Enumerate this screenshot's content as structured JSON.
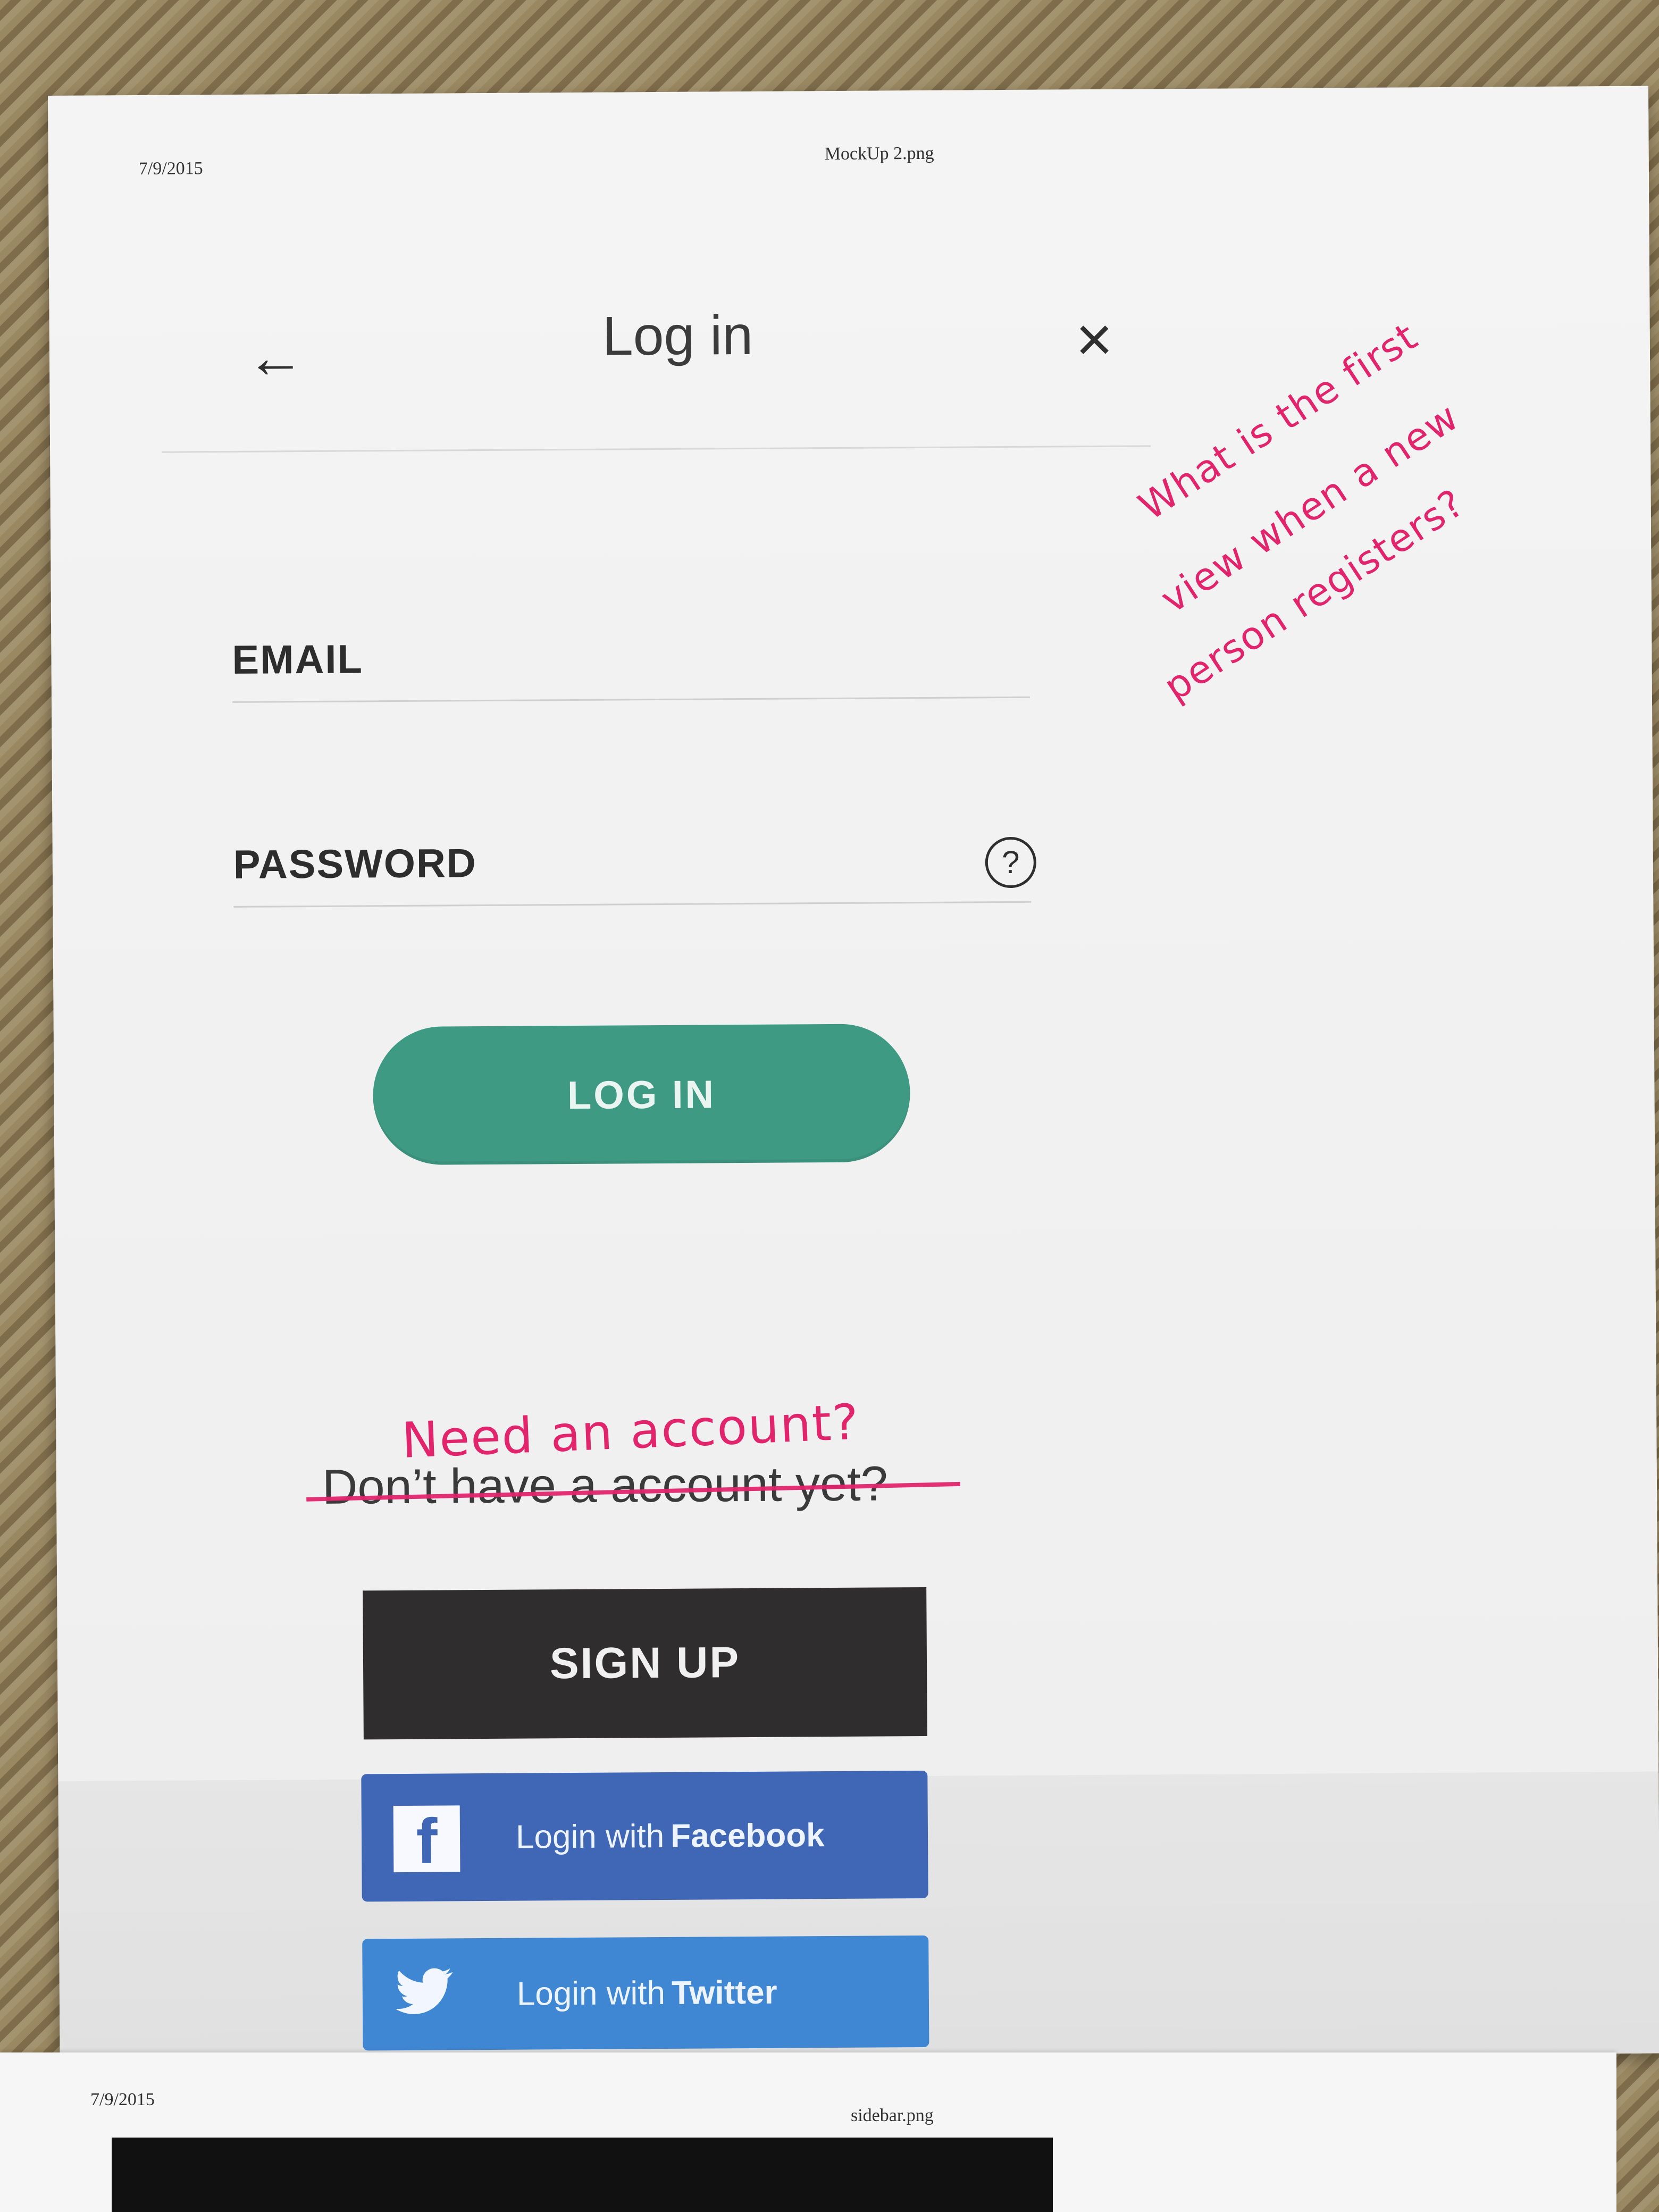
{
  "print": {
    "date": "7/9/2015",
    "file": "MockUp 2.png"
  },
  "header": {
    "title": "Log in",
    "back_icon": "arrow-left-icon",
    "close_icon": "close-icon"
  },
  "form": {
    "email_label": "EMAIL",
    "password_label": "PASSWORD",
    "help_icon": "question-circle-icon",
    "help_symbol": "?"
  },
  "actions": {
    "login_label": "LOG IN",
    "struck_prompt": "Don’t have a account yet?",
    "annotation_prompt": "Need an account?",
    "signup_label": "SIGN UP"
  },
  "social": {
    "facebook_prefix": "Login with",
    "facebook_name": "Facebook",
    "twitter_prefix": "Login with",
    "twitter_name": "Twitter"
  },
  "annotations": {
    "note_line_1": "What is the first",
    "note_line_2": "view when a new",
    "note_line_3": "person registers?"
  },
  "lower_page": {
    "date": "7/9/2015",
    "file": "sidebar.png"
  },
  "colors": {
    "login_button": "#3f9a83",
    "signup_button": "#2f2d2d",
    "facebook": "#3f67b5",
    "twitter": "#3f86d3",
    "annotation": "#e2246d"
  }
}
